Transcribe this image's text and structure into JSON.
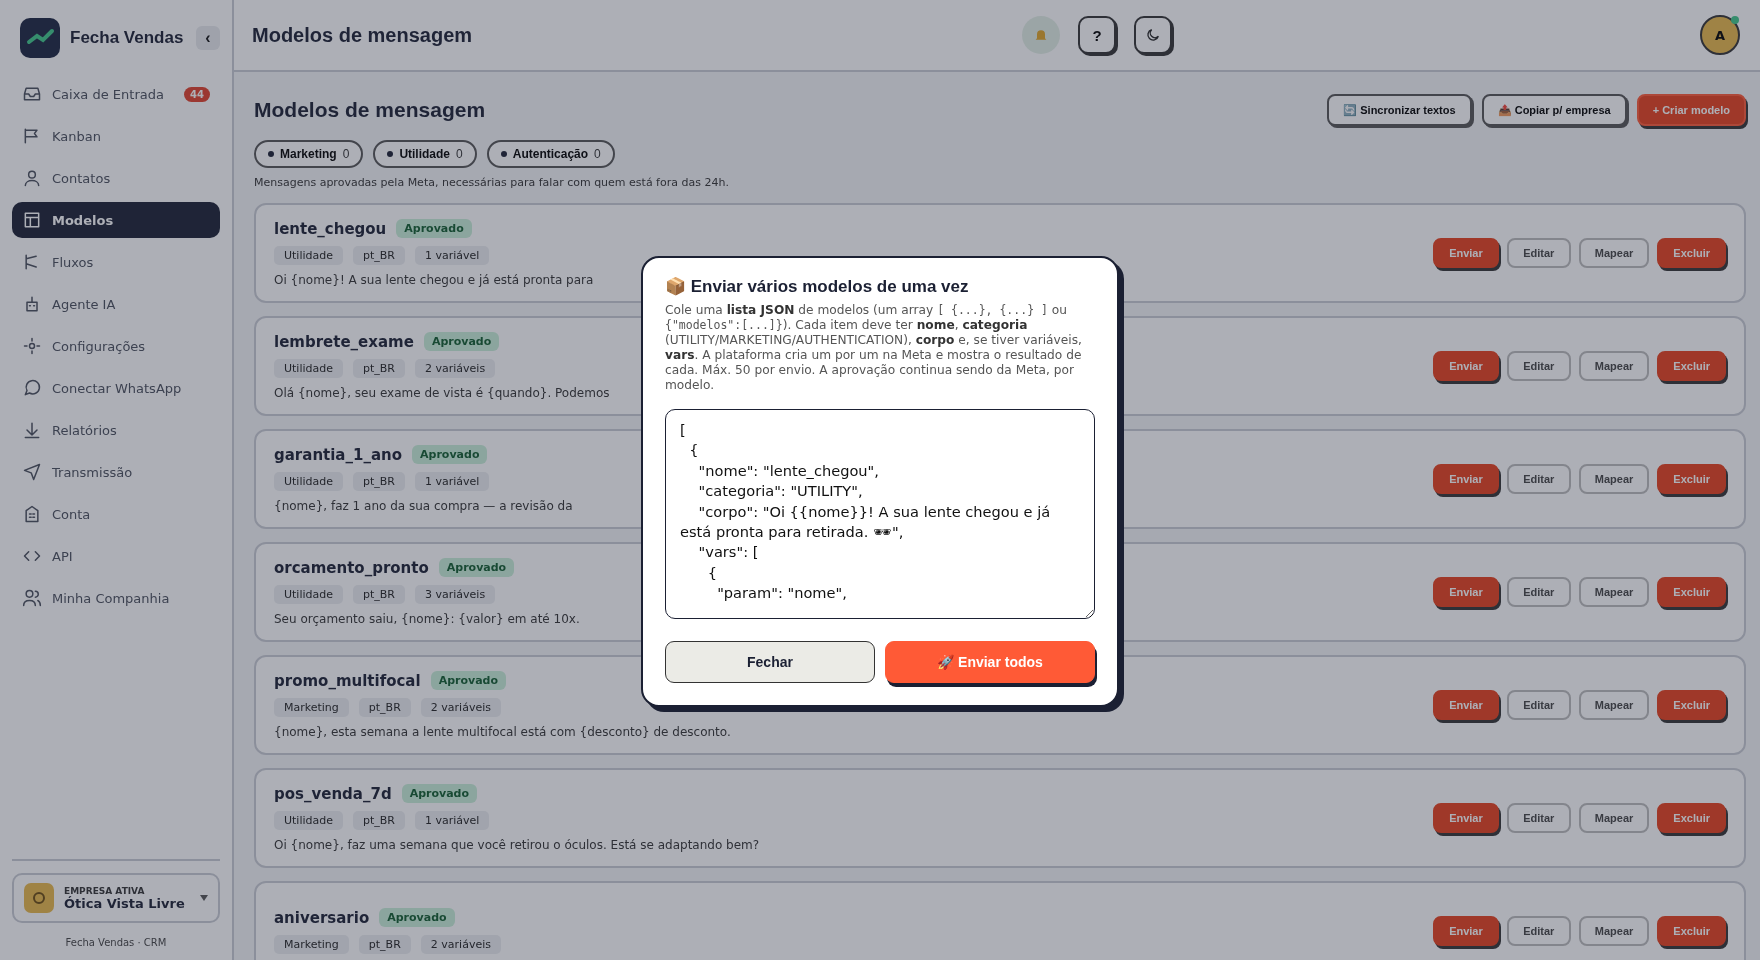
{
  "sidebar": {
    "brand": "Fecha Vendas",
    "collapse": "‹",
    "items": [
      {
        "label": "Caixa de Entrada",
        "badge": "44",
        "selected": false
      },
      {
        "label": "Kanban",
        "selected": false
      },
      {
        "label": "Contatos",
        "selected": false
      },
      {
        "label": "Modelos",
        "selected": true
      },
      {
        "label": "Fluxos",
        "selected": false
      },
      {
        "label": "Agente IA",
        "selected": false
      },
      {
        "label": "Configurações",
        "selected": false
      },
      {
        "label": "Conectar WhatsApp",
        "selected": false
      },
      {
        "label": "Relatórios",
        "selected": false
      },
      {
        "label": "Transmissão",
        "selected": false
      },
      {
        "label": "Conta",
        "selected": false
      },
      {
        "label": "API",
        "selected": false
      },
      {
        "label": "Minha Companhia",
        "selected": false
      }
    ],
    "company": {
      "caption": "EMPRESA ATIVA",
      "name": "Ótica Vista Livre"
    },
    "footer": "Fecha Vendas · CRM"
  },
  "header": {
    "title": "Modelos de mensagem",
    "help": "?",
    "avatar": "A"
  },
  "page": {
    "title": "Modelos de mensagem",
    "actions": [
      {
        "label": "🔄 Sincronizar textos",
        "kind": "secondary"
      },
      {
        "label": "📤 Copiar p/ empresa",
        "kind": "secondary"
      },
      {
        "label": "+ Criar modelo",
        "kind": "primary"
      }
    ],
    "filters": [
      {
        "label": "Marketing",
        "count": "0"
      },
      {
        "label": "Utilidade",
        "count": "0"
      },
      {
        "label": "Autenticação",
        "count": "0"
      }
    ],
    "subtitle": "Mensagens aprovadas pela Meta, necessárias para falar com quem está fora das 24h."
  },
  "templates": [
    {
      "name": "lente_chegou",
      "status": "Aprovado",
      "tags": [
        "Utilidade",
        "pt_BR",
        "1 variável"
      ],
      "body": "Oi {nome}! A sua lente chegou e já está pronta para",
      "actions": [
        {
          "label": "Enviar",
          "kind": "accent"
        },
        {
          "label": "Editar",
          "kind": "plain"
        },
        {
          "label": "Mapear",
          "kind": "plain"
        },
        {
          "label": "Excluir",
          "kind": "danger"
        }
      ]
    },
    {
      "name": "lembrete_exame",
      "status": "Aprovado",
      "tags": [
        "Utilidade",
        "pt_BR",
        "2 variáveis"
      ],
      "body": "Olá {nome}, seu exame de vista é {quando}. Podemos",
      "actions": [
        {
          "label": "Enviar",
          "kind": "accent"
        },
        {
          "label": "Editar",
          "kind": "plain"
        },
        {
          "label": "Mapear",
          "kind": "plain"
        },
        {
          "label": "Excluir",
          "kind": "danger"
        }
      ]
    },
    {
      "name": "garantia_1_ano",
      "status": "Aprovado",
      "tags": [
        "Utilidade",
        "pt_BR",
        "1 variável"
      ],
      "body": "{nome}, faz 1 ano da sua compra — a revisão da",
      "actions": [
        {
          "label": "Enviar",
          "kind": "accent"
        },
        {
          "label": "Editar",
          "kind": "plain"
        },
        {
          "label": "Mapear",
          "kind": "plain"
        },
        {
          "label": "Excluir",
          "kind": "danger"
        }
      ]
    },
    {
      "name": "orcamento_pronto",
      "status": "Aprovado",
      "tags": [
        "Utilidade",
        "pt_BR",
        "3 variáveis"
      ],
      "body": "Seu orçamento saiu, {nome}: {valor} em até 10x.",
      "actions": [
        {
          "label": "Enviar",
          "kind": "accent"
        },
        {
          "label": "Editar",
          "kind": "plain"
        },
        {
          "label": "Mapear",
          "kind": "plain"
        },
        {
          "label": "Excluir",
          "kind": "danger"
        }
      ]
    },
    {
      "name": "promo_multifocal",
      "status": "Aprovado",
      "tags": [
        "Marketing",
        "pt_BR",
        "2 variáveis"
      ],
      "body": "{nome}, esta semana a lente multifocal está com {desconto} de desconto.",
      "actions": [
        {
          "label": "Enviar",
          "kind": "accent"
        },
        {
          "label": "Editar",
          "kind": "plain"
        },
        {
          "label": "Mapear",
          "kind": "plain"
        },
        {
          "label": "Excluir",
          "kind": "danger"
        }
      ]
    },
    {
      "name": "pos_venda_7d",
      "status": "Aprovado",
      "tags": [
        "Utilidade",
        "pt_BR",
        "1 variável"
      ],
      "body": "Oi {nome}, faz uma semana que você retirou o óculos. Está se adaptando bem?",
      "actions": [
        {
          "label": "Enviar",
          "kind": "accent"
        },
        {
          "label": "Editar",
          "kind": "plain"
        },
        {
          "label": "Mapear",
          "kind": "plain"
        },
        {
          "label": "Excluir",
          "kind": "danger"
        }
      ]
    },
    {
      "name": "aniversario",
      "status": "Aprovado",
      "tags": [
        "Marketing",
        "pt_BR",
        "2 variáveis"
      ],
      "actions": [
        {
          "label": "Enviar",
          "kind": "accent"
        },
        {
          "label": "Editar",
          "kind": "plain"
        },
        {
          "label": "Mapear",
          "kind": "plain"
        },
        {
          "label": "Excluir",
          "kind": "danger"
        }
      ]
    }
  ],
  "modal": {
    "title": "📦 Enviar vários modelos de uma vez",
    "description": [
      {
        "kind": "text",
        "text": "Cole uma **lista JSON** de modelos (um array "
      },
      {
        "kind": "code",
        "text": "[ {...}, {...} ]"
      },
      {
        "kind": "text",
        "text": " ou "
      },
      {
        "kind": "code",
        "text": "{\"modelos\":[...]}"
      },
      {
        "kind": "text",
        "text": "). Cada item deve ter **nome**, **categoria** (UTILITY/MARKETING/AUTHENTICATION), **corpo** e, se tiver variáveis, **vars**. A plataforma cria um por um na Meta e mostra o resultado de cada. Máx. 50 por envio. A aprovação continua sendo da Meta, por modelo."
      }
    ],
    "json_input": "[\n  {\n    \"nome\": \"lente_chegou\",\n    \"categoria\": \"UTILITY\",\n    \"corpo\": \"Oi {{nome}}! A sua lente chegou e já está pronta para retirada. 🕶\",\n    \"vars\": [\n      {\n        \"param\": \"nome\",",
    "buttons": [
      {
        "label": "Fechar",
        "kind": "cancel"
      },
      {
        "label": "🚀 Enviar todos",
        "kind": "submit"
      }
    ]
  }
}
